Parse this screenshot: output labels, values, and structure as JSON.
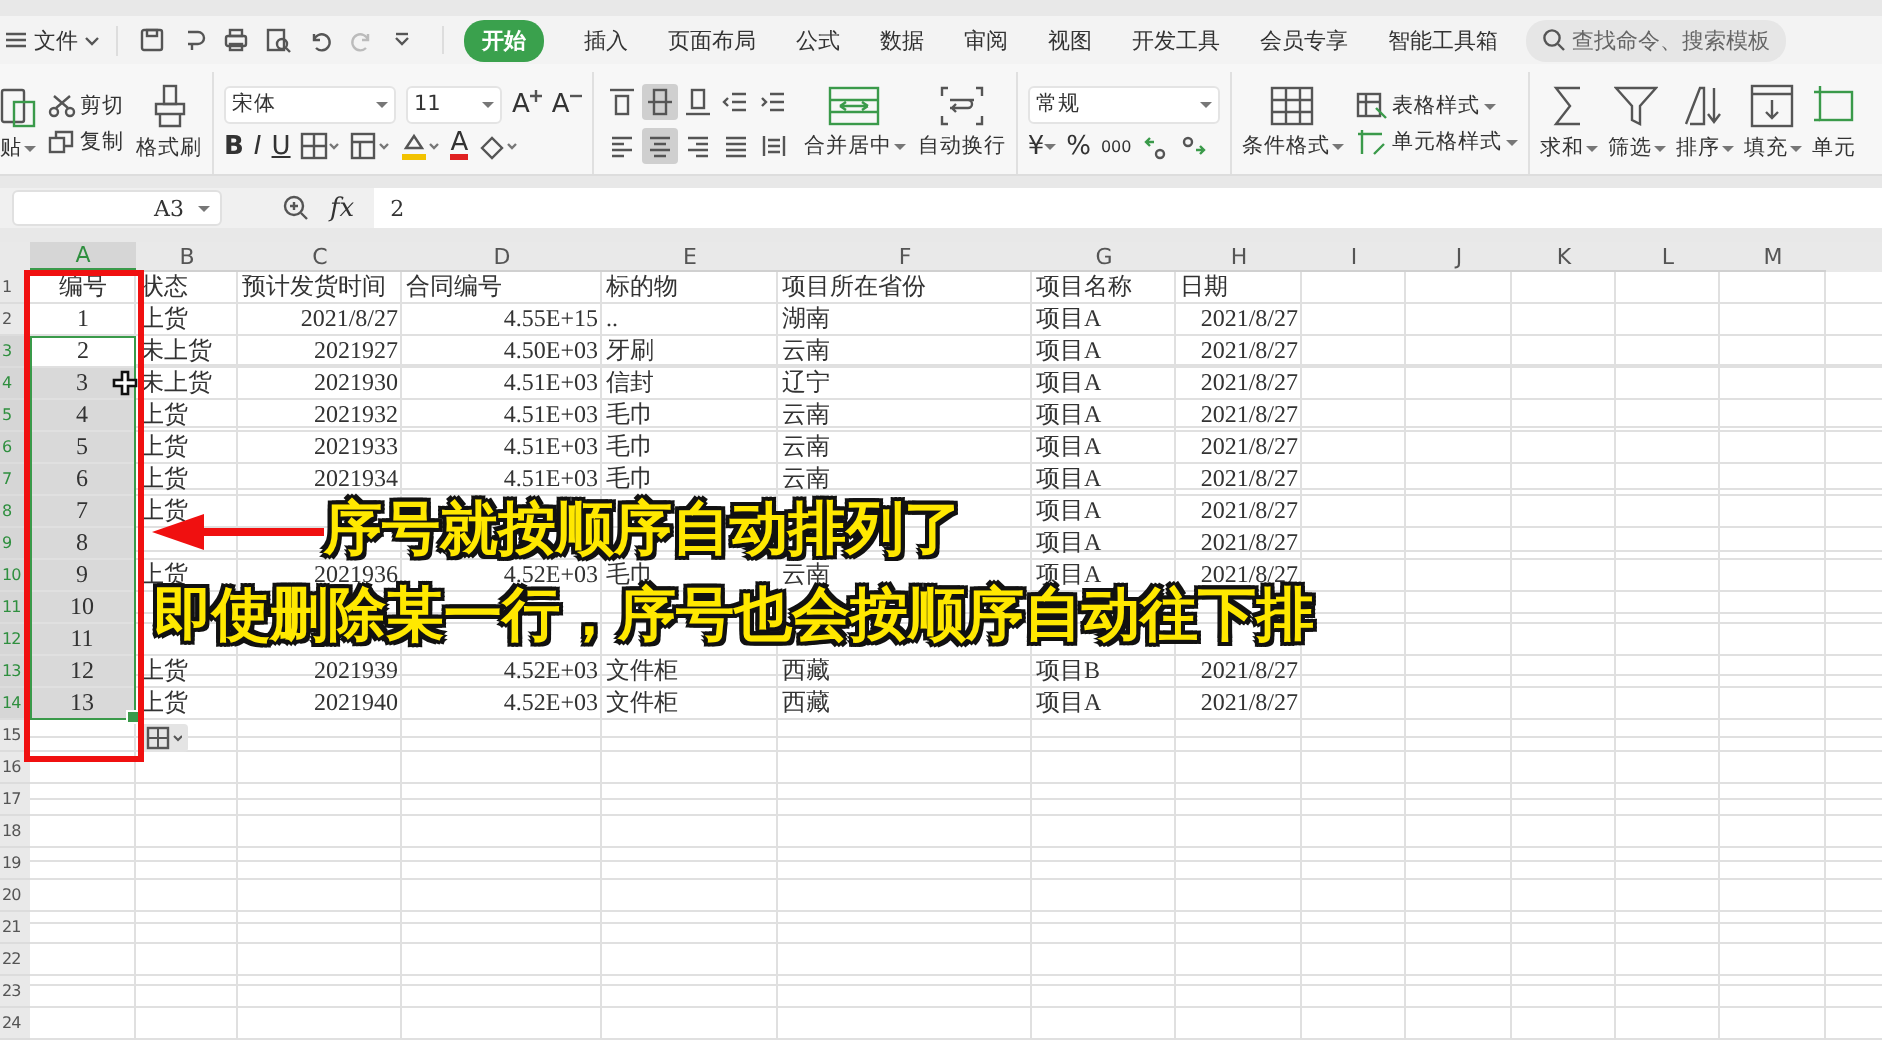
{
  "menu": {
    "file": "文件",
    "tabs": [
      {
        "label": "开始",
        "selected": true
      },
      {
        "label": "插入",
        "selected": false
      },
      {
        "label": "页面布局",
        "selected": false
      },
      {
        "label": "公式",
        "selected": false
      },
      {
        "label": "数据",
        "selected": false
      },
      {
        "label": "审阅",
        "selected": false
      },
      {
        "label": "视图",
        "selected": false
      },
      {
        "label": "开发工具",
        "selected": false
      },
      {
        "label": "会员专享",
        "selected": false
      },
      {
        "label": "智能工具箱",
        "selected": false
      }
    ],
    "search": {
      "placeholder": "查找命令、搜索模板"
    }
  },
  "ribbon": {
    "paste": "贴",
    "cut": "剪切",
    "copy": "复制",
    "format_painter": "格式刷",
    "font": "宋体",
    "font_size": "11",
    "grow": "A",
    "shrink": "A",
    "bold": "B",
    "italic": "I",
    "underline": "U",
    "font_color": "A",
    "merge": "合并居中",
    "wrap": "自动换行",
    "number_format": "常规",
    "currency": "¥",
    "percent": "%",
    "thousands": "000",
    "conditional": "条件格式",
    "table_style": "表格样式",
    "cell_style": "单元格样式",
    "sum": "求和",
    "filter": "筛选",
    "sort": "排序",
    "fill": "填充",
    "cells": "单元",
    "align_buttons": [
      {
        "selected": false
      },
      {
        "selected": true
      },
      {
        "selected": false
      },
      {
        "selected": false
      },
      {
        "selected": false
      },
      {
        "selected": false
      },
      {
        "selected": true
      },
      {
        "selected": false
      },
      {
        "selected": false
      },
      {
        "selected": false
      }
    ]
  },
  "formula_bar": {
    "name_box": "A3",
    "fx": "fx",
    "value": "2"
  },
  "sheet": {
    "columns": [
      {
        "label": "A",
        "selected": true
      },
      {
        "label": "B",
        "selected": false
      },
      {
        "label": "C",
        "selected": false
      },
      {
        "label": "D",
        "selected": false
      },
      {
        "label": "E",
        "selected": false
      },
      {
        "label": "F",
        "selected": false
      },
      {
        "label": "G",
        "selected": false
      },
      {
        "label": "H",
        "selected": false
      },
      {
        "label": "I",
        "selected": false
      },
      {
        "label": "J",
        "selected": false
      },
      {
        "label": "K",
        "selected": false
      },
      {
        "label": "L",
        "selected": false
      },
      {
        "label": "M",
        "selected": false
      }
    ],
    "rows": [
      {
        "number": "1",
        "selected": false,
        "cells": [
          "编号",
          "状态",
          "预计发货时间",
          "合同编号",
          "标的物",
          "项目所在省份",
          "项目名称",
          "日期"
        ]
      },
      {
        "number": "2",
        "selected": false,
        "cells": [
          "1",
          "上货",
          "2021/8/27",
          "4.55E+15",
          "..",
          "湖南",
          "项目A",
          "2021/8/27"
        ]
      },
      {
        "number": "3",
        "selected": true,
        "cells": [
          "2",
          "未上货",
          "2021927",
          "4.50E+03",
          "牙刷",
          "云南",
          "项目A",
          "2021/8/27"
        ]
      },
      {
        "number": "4",
        "selected": true,
        "cells": [
          "3",
          "未上货",
          "2021930",
          "4.51E+03",
          "信封",
          "辽宁",
          "项目A",
          "2021/8/27"
        ]
      },
      {
        "number": "5",
        "selected": true,
        "cells": [
          "4",
          "上货",
          "2021932",
          "4.51E+03",
          "毛巾",
          "云南",
          "项目A",
          "2021/8/27"
        ]
      },
      {
        "number": "6",
        "selected": true,
        "cells": [
          "5",
          "上货",
          "2021933",
          "4.51E+03",
          "毛巾",
          "云南",
          "项目A",
          "2021/8/27"
        ]
      },
      {
        "number": "7",
        "selected": true,
        "cells": [
          "6",
          "上货",
          "2021934",
          "4.51E+03",
          "毛巾",
          "云南",
          "项目A",
          "2021/8/27"
        ]
      },
      {
        "number": "8",
        "selected": true,
        "cells": [
          "7",
          "上货",
          null,
          null,
          null,
          null,
          "项目A",
          "2021/8/27"
        ]
      },
      {
        "number": "9",
        "selected": true,
        "cells": [
          "8",
          null,
          null,
          null,
          null,
          null,
          "项目A",
          "2021/8/27"
        ]
      },
      {
        "number": "10",
        "selected": true,
        "cells": [
          "9",
          "上货",
          "2021936",
          "4.52E+03",
          "毛巾",
          "云南",
          "项目A",
          "2021/8/27"
        ]
      },
      {
        "number": "11",
        "selected": true,
        "cells": [
          "10"
        ]
      },
      {
        "number": "12",
        "selected": true,
        "cells": [
          "11"
        ]
      },
      {
        "number": "13",
        "selected": true,
        "cells": [
          "12",
          "上货",
          "2021939",
          "4.52E+03",
          "文件柜",
          "西藏",
          "项目B",
          "2021/8/27"
        ]
      },
      {
        "number": "14",
        "selected": true,
        "cells": [
          "13",
          "上货",
          "2021940",
          "4.52E+03",
          "文件柜",
          "西藏",
          "项目A",
          "2021/8/27"
        ]
      },
      {
        "number": "15",
        "selected": false,
        "cells": []
      },
      {
        "number": "16",
        "selected": false,
        "cells": []
      },
      {
        "number": "17",
        "selected": false,
        "cells": []
      },
      {
        "number": "18",
        "selected": false,
        "cells": []
      },
      {
        "number": "19",
        "selected": false,
        "cells": []
      },
      {
        "number": "20",
        "selected": false,
        "cells": []
      },
      {
        "number": "21",
        "selected": false,
        "cells": []
      },
      {
        "number": "22",
        "selected": false,
        "cells": []
      },
      {
        "number": "23",
        "selected": false,
        "cells": []
      },
      {
        "number": "24",
        "selected": false,
        "cells": []
      }
    ]
  },
  "annotations": {
    "callout": "序号就按顺序自动排列了",
    "note": "即使删除某一行，序号也会按顺序自动往下排"
  }
}
